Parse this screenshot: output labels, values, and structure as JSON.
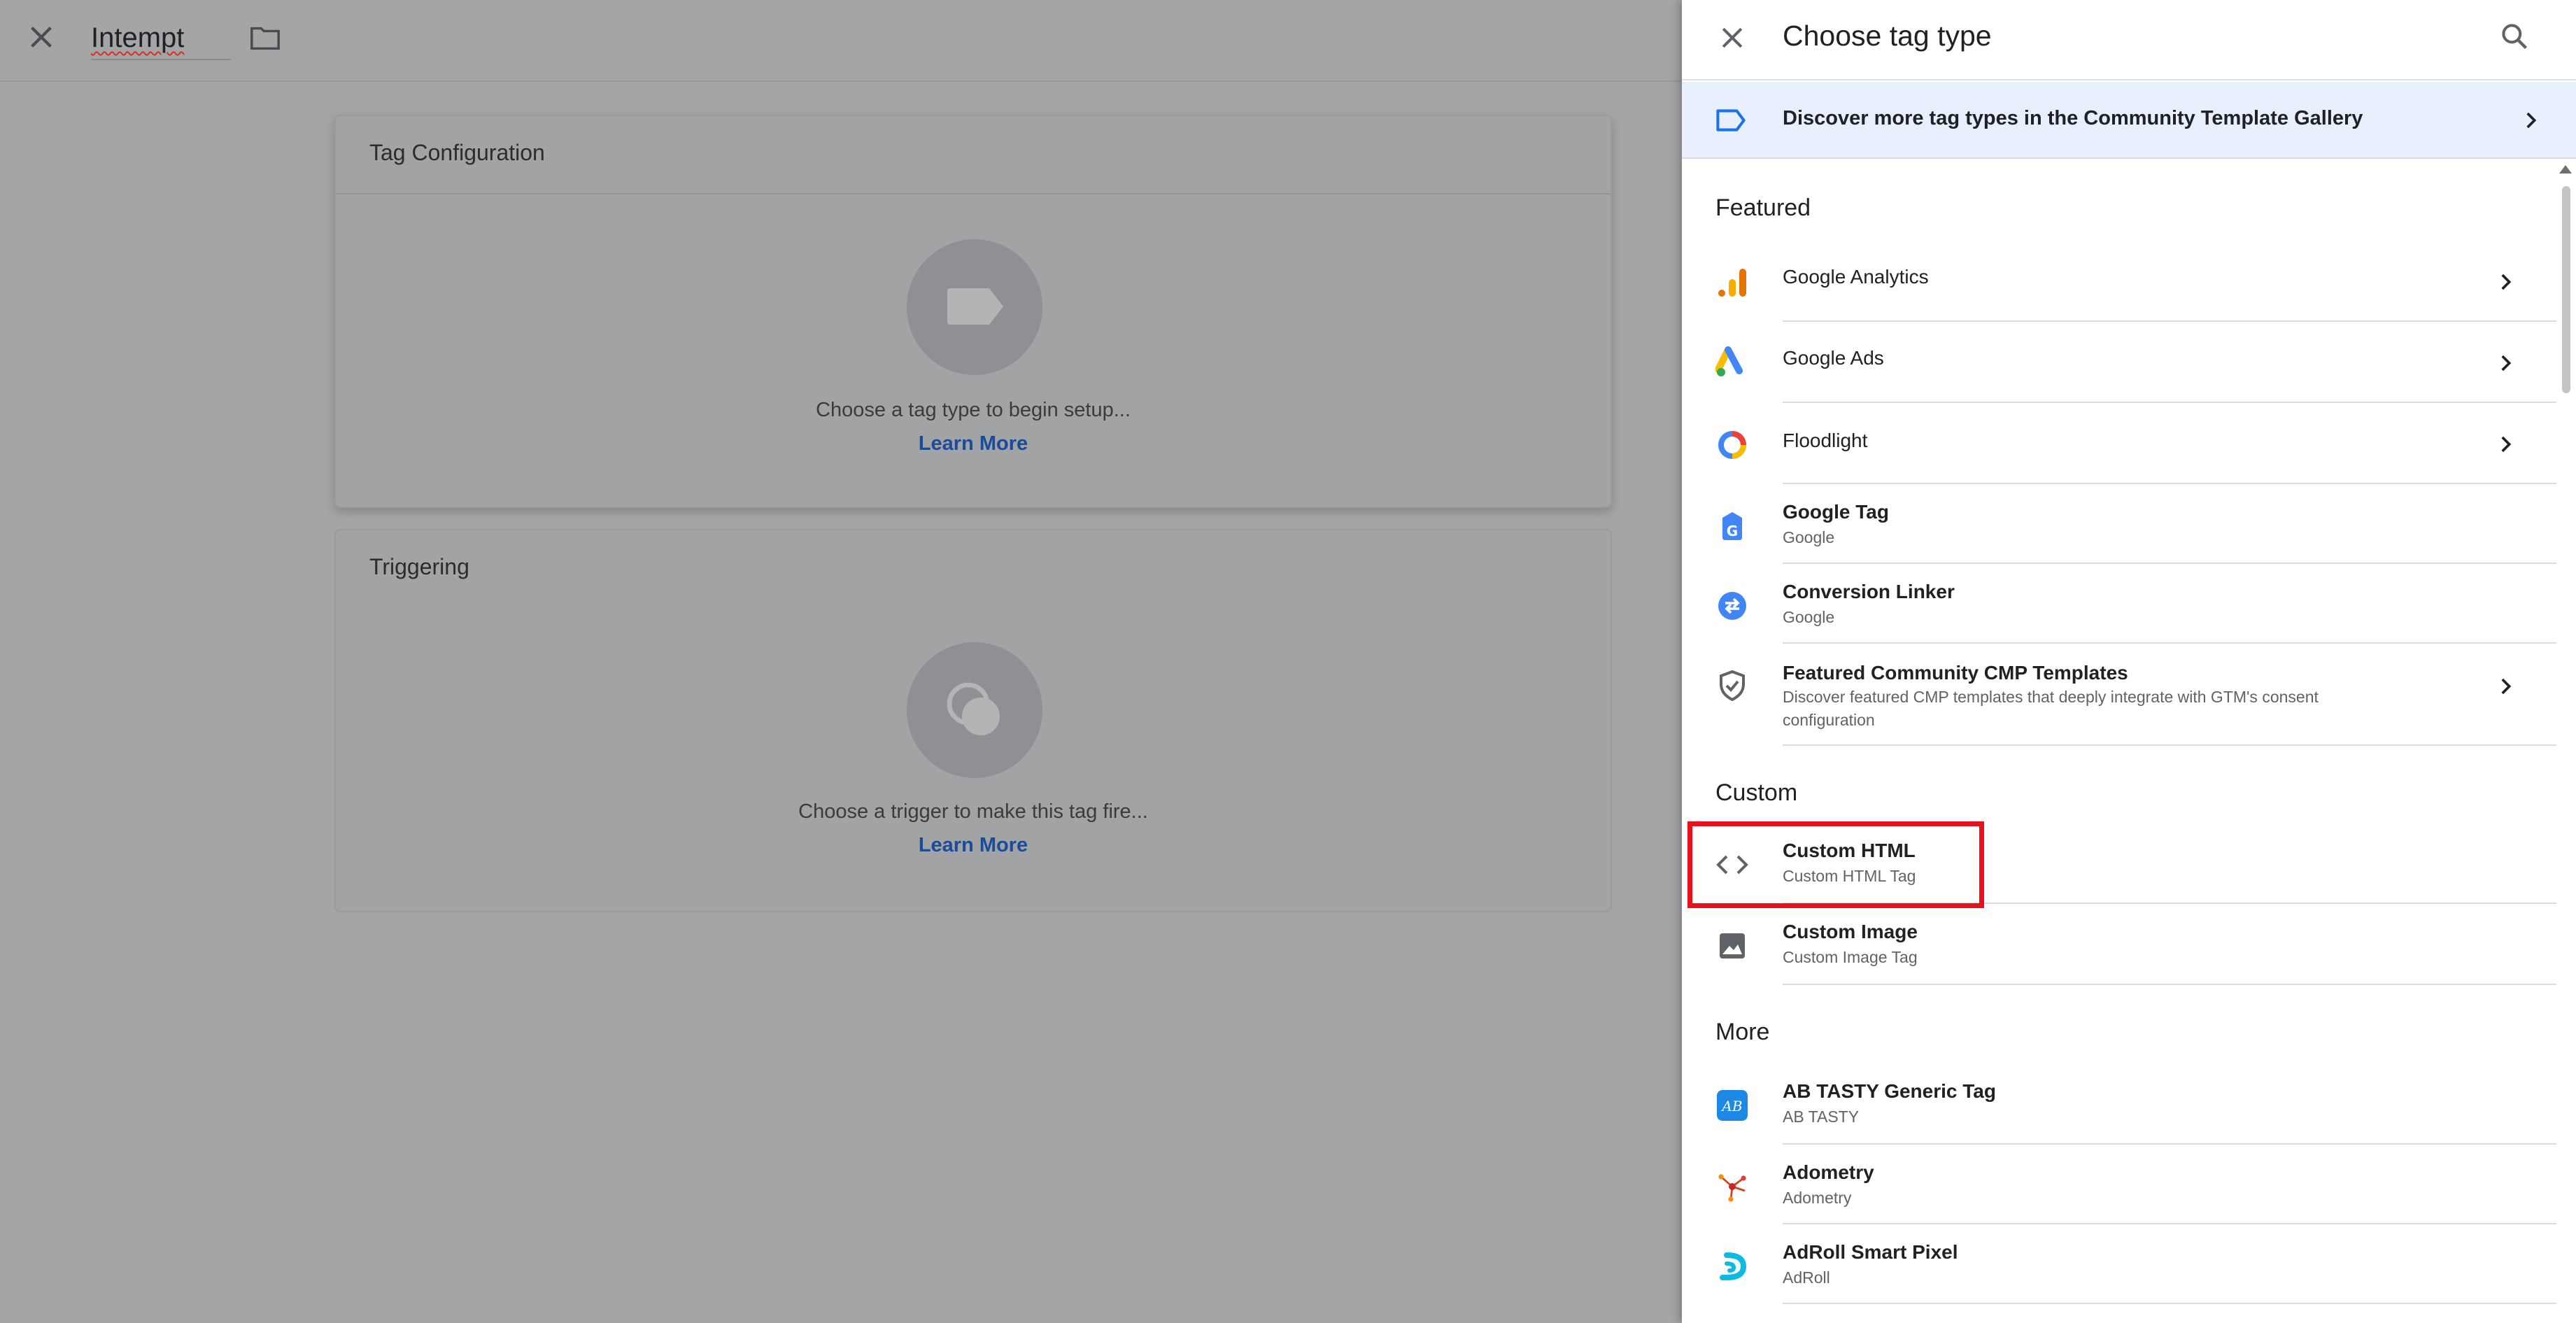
{
  "editor": {
    "tag_name": "Intempt",
    "config_card": {
      "title": "Tag Configuration",
      "hint": "Choose a tag type to begin setup...",
      "link": "Learn More"
    },
    "trigger_card": {
      "title": "Triggering",
      "hint": "Choose a trigger to make this tag fire...",
      "link": "Learn More"
    }
  },
  "drawer": {
    "title": "Choose tag type",
    "discover_text": "Discover more tag types in the Community Template Gallery",
    "sections": {
      "featured": "Featured",
      "custom": "Custom",
      "more": "More"
    },
    "featured_items": [
      {
        "title": "Google Analytics",
        "icon": "google-analytics-icon"
      },
      {
        "title": "Google Ads",
        "icon": "google-ads-icon"
      },
      {
        "title": "Floodlight",
        "icon": "floodlight-icon"
      },
      {
        "title": "Google Tag",
        "subtitle": "Google",
        "icon": "google-tag-icon"
      },
      {
        "title": "Conversion Linker",
        "subtitle": "Google",
        "icon": "conversion-linker-icon"
      },
      {
        "title": "Featured Community CMP Templates",
        "subtitle": "Discover featured CMP templates that deeply integrate with GTM's consent configuration",
        "icon": "shield-check-icon"
      }
    ],
    "custom_items": [
      {
        "title": "Custom HTML",
        "subtitle": "Custom HTML Tag",
        "icon": "code-brackets-icon"
      },
      {
        "title": "Custom Image",
        "subtitle": "Custom Image Tag",
        "icon": "image-icon"
      }
    ],
    "more_items": [
      {
        "title": "AB TASTY Generic Tag",
        "subtitle": "AB TASTY",
        "icon": "ab-tasty-icon"
      },
      {
        "title": "Adometry",
        "subtitle": "Adometry",
        "icon": "adometry-icon"
      },
      {
        "title": "AdRoll Smart Pixel",
        "subtitle": "AdRoll",
        "icon": "adroll-icon"
      }
    ]
  },
  "colors": {
    "accent_blue": "#1a73e8",
    "highlight_red": "#e8101a",
    "discover_bg": "#e8f0fe"
  }
}
